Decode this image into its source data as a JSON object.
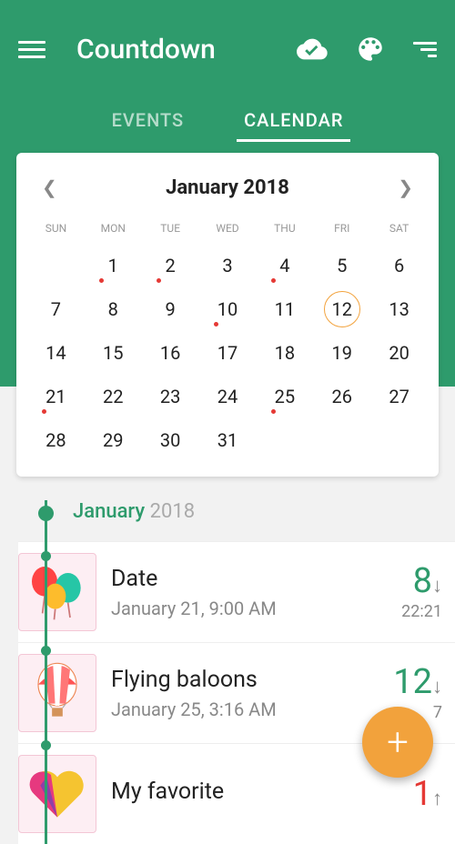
{
  "colors": {
    "primary": "#2e9b6c",
    "accent": "#f2a23c",
    "danger": "#e53935"
  },
  "header": {
    "title": "Countdown"
  },
  "tabs": {
    "events": "EVENTS",
    "calendar": "CALENDAR",
    "active": "calendar"
  },
  "calendar": {
    "title": "January 2018",
    "dow": [
      "SUN",
      "MON",
      "TUE",
      "WED",
      "THU",
      "FRI",
      "SAT"
    ],
    "today": 12,
    "dots": [
      1,
      2,
      4,
      10,
      21,
      25
    ],
    "weeks": [
      [
        "",
        1,
        2,
        3,
        4,
        5,
        6
      ],
      [
        7,
        8,
        9,
        10,
        11,
        12,
        13
      ],
      [
        14,
        15,
        16,
        17,
        18,
        19,
        20
      ],
      [
        21,
        22,
        23,
        24,
        25,
        26,
        27
      ],
      [
        28,
        29,
        30,
        31,
        "",
        "",
        ""
      ]
    ]
  },
  "timeline": {
    "month": "January",
    "year": "2018",
    "events": [
      {
        "title": "Date",
        "subtitle": "January 21, 9:00 AM",
        "count": "8",
        "dir": "down",
        "color": "green",
        "time": "22:21",
        "icon": "balloons"
      },
      {
        "title": "Flying baloons",
        "subtitle": "January 25, 3:16 AM",
        "count": "12",
        "dir": "down",
        "color": "green",
        "time": "7",
        "icon": "hot-air-balloon"
      },
      {
        "title": "My favorite",
        "subtitle": "",
        "count": "1",
        "dir": "up",
        "color": "red",
        "time": "",
        "icon": "heart"
      }
    ]
  }
}
